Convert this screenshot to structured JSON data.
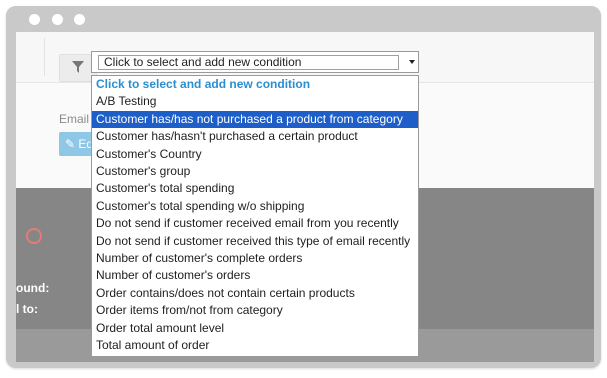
{
  "window": {
    "controls": [
      "close",
      "minimize",
      "maximize"
    ]
  },
  "toolbar": {
    "filter_icon": "filter-icon"
  },
  "email_section": {
    "label": "Email s",
    "edit_label": "✎ Ed"
  },
  "background_labels": {
    "found": "ound:",
    "sent_to": "l to:"
  },
  "status_icon": "circle-icon",
  "condition_select": {
    "value": "Click to select and add new condition",
    "options": [
      "Click to select and add new condition",
      "A/B Testing",
      "Customer has/has not purchased a product from category",
      "Customer has/hasn't purchased a certain product",
      "Customer's Country",
      "Customer's group",
      "Customer's total spending",
      "Customer's total spending w/o shipping",
      "Do not send if customer received email from you recently",
      "Do not send if customer received this type of email recently",
      "Number of customer's complete orders",
      "Number of customer's orders",
      "Order contains/does not contain certain products",
      "Order items from/not from category",
      "Order total amount level",
      "Total amount of order"
    ],
    "highlighted": "Customer has/has not purchased a product from category"
  },
  "colors": {
    "accent": "#2a8fd0",
    "highlight": "#1e5ec8",
    "edit_button": "#8fc8e6",
    "warning": "#e47c72"
  }
}
